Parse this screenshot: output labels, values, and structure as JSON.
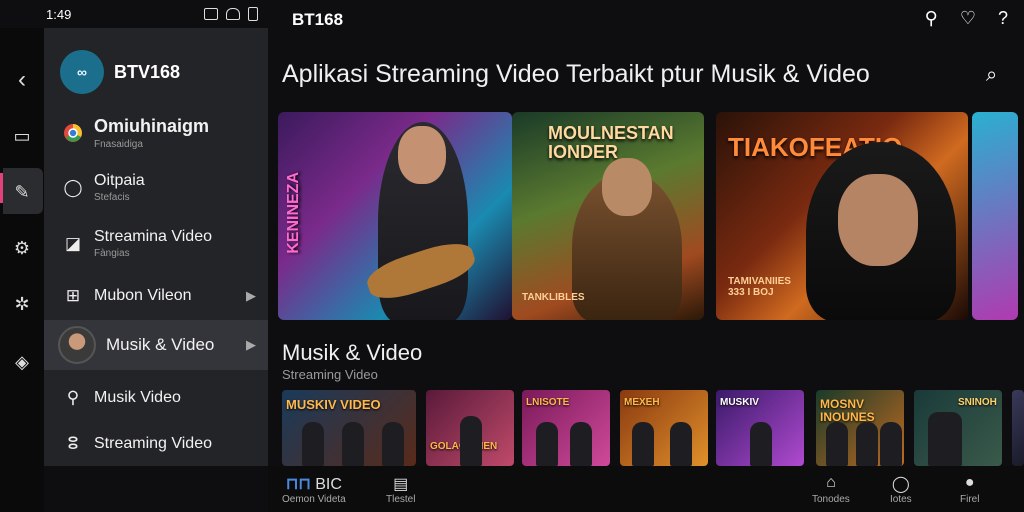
{
  "status": {
    "time": "1:49"
  },
  "app": {
    "title": "BT168"
  },
  "drawer": {
    "brand": "BTV168",
    "items": [
      {
        "label": "Omiuhinaigm",
        "sub": "Fnasaidiga",
        "icon": "chrome-icon"
      },
      {
        "label": "Oitpaia",
        "sub": "Stefacis",
        "icon": "chat-icon"
      },
      {
        "label": "Streamina Video",
        "sub": "Fàngias",
        "icon": "video-icon"
      },
      {
        "label": "Mubon Vileon",
        "sub": "",
        "icon": "grid-icon"
      },
      {
        "label": "Musik & Video",
        "sub": "",
        "icon": "avatar"
      },
      {
        "label": "Musik Video",
        "sub": "",
        "icon": "pin-icon"
      },
      {
        "label": "Streaming Video",
        "sub": "",
        "icon": "loop-icon"
      }
    ]
  },
  "main": {
    "title": "Aplikasi Streaming Video Terbaikt ptur Musik & Video",
    "hero_cards": [
      {
        "title": "KENINEZA",
        "caption": ""
      },
      {
        "title": "MOULNESTAN IONDER",
        "caption": "TANKLIBLES"
      },
      {
        "title": "TIAKOFEATIO",
        "caption": "TAMIVANIIES 333 I BOJ"
      }
    ],
    "section": {
      "title": "Musik & Video",
      "subtitle": "Streaming Video"
    },
    "thumbs": [
      {
        "title": "MUSKIV VIDEO"
      },
      {
        "title": "GOLAOIENEN"
      },
      {
        "title": "LNISOTE"
      },
      {
        "title": "MEXEH"
      },
      {
        "title": "MUSKIV"
      },
      {
        "title": "MOSNV INOUNES"
      },
      {
        "title": "SNINOH"
      }
    ]
  },
  "bottom_nav": [
    {
      "label": "Oemon Videta",
      "icon": "film-icon",
      "extra": "BIC"
    },
    {
      "label": "Tlestel",
      "icon": "list-icon"
    },
    {
      "label": "Tonodes",
      "icon": "store-icon"
    },
    {
      "label": "Iotes",
      "icon": "chat-bubble-icon"
    },
    {
      "label": "Firel",
      "icon": "user-icon"
    }
  ],
  "colors": {
    "accent": "#e2427a",
    "drawer_bg": "#232427",
    "bg": "#0e0e10"
  }
}
